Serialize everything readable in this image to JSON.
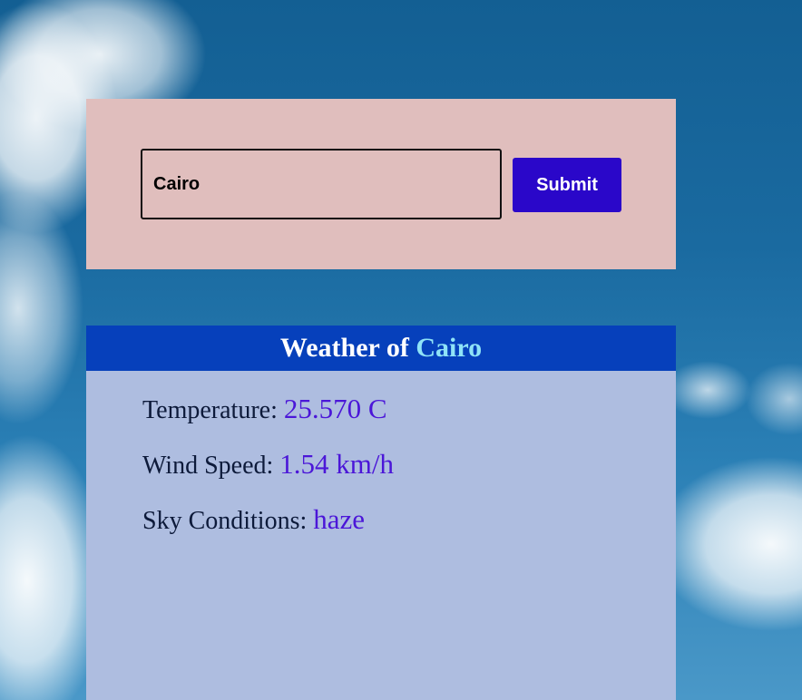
{
  "search": {
    "input_value": "Cairo",
    "submit_label": "Submit"
  },
  "weather": {
    "header_prefix": "Weather of",
    "city": "Cairo",
    "temperature_label": "Temperature:",
    "temperature_value": "25.570 C",
    "wind_label": "Wind Speed:",
    "wind_value": "1.54 km/h",
    "sky_label": "Sky Conditions:",
    "sky_value": "haze"
  },
  "colors": {
    "search_panel_bg": "#e0bebd",
    "submit_bg": "#2a07c9",
    "header_bg": "#0640bb",
    "card_bg": "#aebde0",
    "value_text": "#4b16d8",
    "city_highlight": "#8fe3f7"
  }
}
